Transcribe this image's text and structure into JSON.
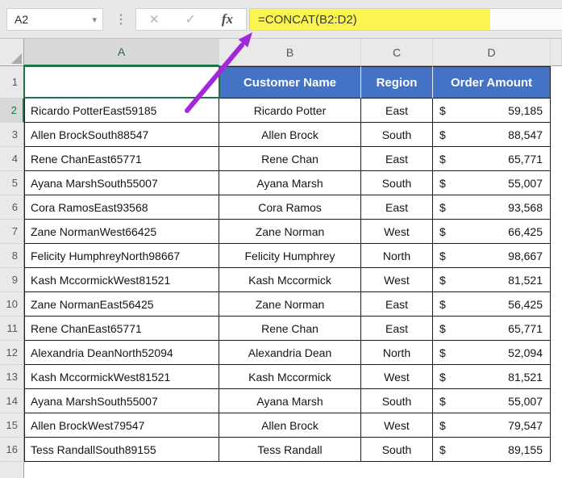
{
  "formula_bar": {
    "name_box_value": "A2",
    "formula": "=CONCAT(B2:D2)",
    "icons": {
      "dropdown": "▾",
      "handle": "⋮",
      "cancel": "✕",
      "enter": "✓",
      "insert_function": "fx"
    }
  },
  "colors": {
    "header_blue": "#4472C4",
    "selection_green": "#1F7246",
    "highlight_yellow": "#FAF64F",
    "arrow_purple": "#A227DB"
  },
  "grid": {
    "column_letters": [
      "A",
      "B",
      "C",
      "D"
    ],
    "row1_label": "1",
    "selected_cell": "A2",
    "header_row": {
      "customer_name": "Customer Name",
      "region": "Region",
      "order_amount": "Order Amount"
    },
    "currency_symbol": "$",
    "rows": [
      {
        "row": 2,
        "concat": "Ricardo PotterEast59185",
        "customer": "Ricardo Potter",
        "region": "East",
        "amount": "59,185"
      },
      {
        "row": 3,
        "concat": "Allen BrockSouth88547",
        "customer": "Allen Brock",
        "region": "South",
        "amount": "88,547"
      },
      {
        "row": 4,
        "concat": "Rene ChanEast65771",
        "customer": "Rene Chan",
        "region": "East",
        "amount": "65,771"
      },
      {
        "row": 5,
        "concat": "Ayana MarshSouth55007",
        "customer": "Ayana Marsh",
        "region": "South",
        "amount": "55,007"
      },
      {
        "row": 6,
        "concat": "Cora RamosEast93568",
        "customer": "Cora Ramos",
        "region": "East",
        "amount": "93,568"
      },
      {
        "row": 7,
        "concat": "Zane NormanWest66425",
        "customer": "Zane Norman",
        "region": "West",
        "amount": "66,425"
      },
      {
        "row": 8,
        "concat": "Felicity HumphreyNorth98667",
        "customer": "Felicity Humphrey",
        "region": "North",
        "amount": "98,667"
      },
      {
        "row": 9,
        "concat": "Kash MccormickWest81521",
        "customer": "Kash Mccormick",
        "region": "West",
        "amount": "81,521"
      },
      {
        "row": 10,
        "concat": "Zane NormanEast56425",
        "customer": "Zane Norman",
        "region": "East",
        "amount": "56,425"
      },
      {
        "row": 11,
        "concat": "Rene ChanEast65771",
        "customer": "Rene Chan",
        "region": "East",
        "amount": "65,771"
      },
      {
        "row": 12,
        "concat": "Alexandria DeanNorth52094",
        "customer": "Alexandria Dean",
        "region": "North",
        "amount": "52,094"
      },
      {
        "row": 13,
        "concat": "Kash MccormickWest81521",
        "customer": "Kash Mccormick",
        "region": "West",
        "amount": "81,521"
      },
      {
        "row": 14,
        "concat": "Ayana MarshSouth55007",
        "customer": "Ayana Marsh",
        "region": "South",
        "amount": "55,007"
      },
      {
        "row": 15,
        "concat": "Allen BrockWest79547",
        "customer": "Allen Brock",
        "region": "West",
        "amount": "79,547"
      },
      {
        "row": 16,
        "concat": "Tess RandallSouth89155",
        "customer": "Tess Randall",
        "region": "South",
        "amount": "89,155"
      }
    ]
  }
}
